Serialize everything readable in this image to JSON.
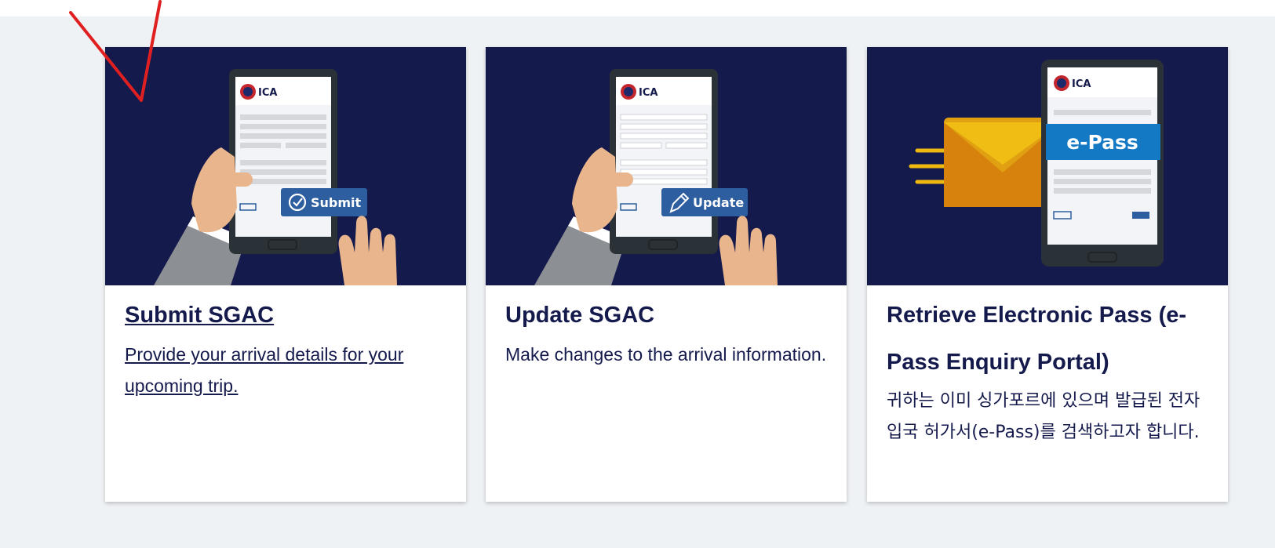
{
  "colors": {
    "navy": "#151a4d",
    "band": "#eff2f5",
    "accent_blue": "#2d5ea0",
    "epass_blue": "#1379c4",
    "annotation_red": "#e02020"
  },
  "cards": [
    {
      "title": "Submit SGAC",
      "description": "Provide your arrival details for your upcoming trip.",
      "button_label": "Submit",
      "button_icon": "check-circle-icon",
      "logo_text": "ICA"
    },
    {
      "title": "Update SGAC",
      "description": "Make changes to the arrival information.",
      "button_label": "Update",
      "button_icon": "pencil-icon",
      "logo_text": "ICA"
    },
    {
      "title": "Retrieve Electronic Pass (e-Pass Enquiry Portal)",
      "description": "귀하는 이미 싱가포르에 있으며 발급된 전자 입국 허가서(e-Pass)를 검색하고자 합니다.",
      "banner_label": "e-Pass",
      "banner_icon": "envelope-icon",
      "logo_text": "ICA"
    }
  ]
}
